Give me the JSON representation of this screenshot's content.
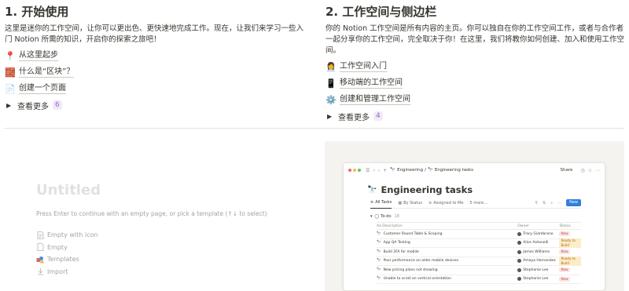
{
  "left": {
    "title": "1. 开始使用",
    "description": "这里是迷你的工作空间，让你可以更出色、更快速地完成工作。现在，让我们来学习一些入门 Notion 所需的知识，开启你的探索之旅吧！",
    "links": [
      {
        "icon": "pin-icon",
        "glyph": "📍",
        "label": "从这里起步"
      },
      {
        "icon": "lego-block-icon",
        "glyph": "🧱",
        "label": "什么是“区块”？"
      },
      {
        "icon": "page-icon",
        "glyph": "📄",
        "label": "创建一个页面"
      }
    ],
    "more_label": "查看更多",
    "more_count": "6"
  },
  "right": {
    "title": "2. 工作空间与侧边栏",
    "description": "你的 Notion 工作空间是所有内容的主页。你可以独自在你的工作空间工作，或者与合作者一起分享你的工作空间，完全取决于你！在这里，我们将教你如何创建、加入和使用工作空间。",
    "links": [
      {
        "icon": "workspace-icon",
        "glyph": "👩‍💼",
        "label": "工作空间入门"
      },
      {
        "icon": "mobile-phone-icon",
        "glyph": "📱",
        "label": "移动端的工作空间"
      },
      {
        "icon": "gears-icon",
        "glyph": "⚙️",
        "label": "创建和管理工作空间"
      }
    ],
    "more_label": "查看更多",
    "more_count": "4"
  },
  "untitled_panel": {
    "title": "Untitled",
    "hint": "Press Enter to continue with an empty page, or pick a template (↑↓ to select)",
    "options": [
      {
        "icon": "page-text-icon",
        "label": "Empty with icon"
      },
      {
        "icon": "empty-page-icon",
        "label": "Empty"
      },
      {
        "icon": "templates-icon",
        "label": "Templates"
      },
      {
        "icon": "import-icon",
        "label": "Import"
      }
    ]
  },
  "preview": {
    "breadcrumb_parent": "Engineering",
    "breadcrumb_sep": "/",
    "breadcrumb_current": "Engineering tasks",
    "share_label": "Share",
    "page_title": "Engineering tasks",
    "tabs": [
      "All Tasks",
      "By Status",
      "Assigned to Me",
      "5 more..."
    ],
    "new_label": "New",
    "group_label": "To-do",
    "group_count": "18",
    "columns": [
      "Aa Description",
      "Owner",
      "Status"
    ],
    "rows": [
      {
        "task": "Customer Round Table & Scoping",
        "owner": "Tracy Giambrano",
        "status": "New"
      },
      {
        "task": "App QA Testing",
        "owner": "Alice Antonelli",
        "status": "Ready to Build"
      },
      {
        "task": "Build 2FA for mobile",
        "owner": "James Williams",
        "status": "New"
      },
      {
        "task": "Poor performance on older mobile devices",
        "owner": "Amaya Hernandez",
        "status": "Ready to Build"
      },
      {
        "task": "New pricing plans not showing",
        "owner": "Stephanie Lee",
        "status": "New"
      },
      {
        "task": "Unable to scroll on vertical orientation",
        "owner": "Stephanie Lee",
        "status": "New"
      }
    ],
    "status_colors": {
      "New": "#fbe4e4",
      "Ready to Build": "#fdecc8"
    }
  }
}
